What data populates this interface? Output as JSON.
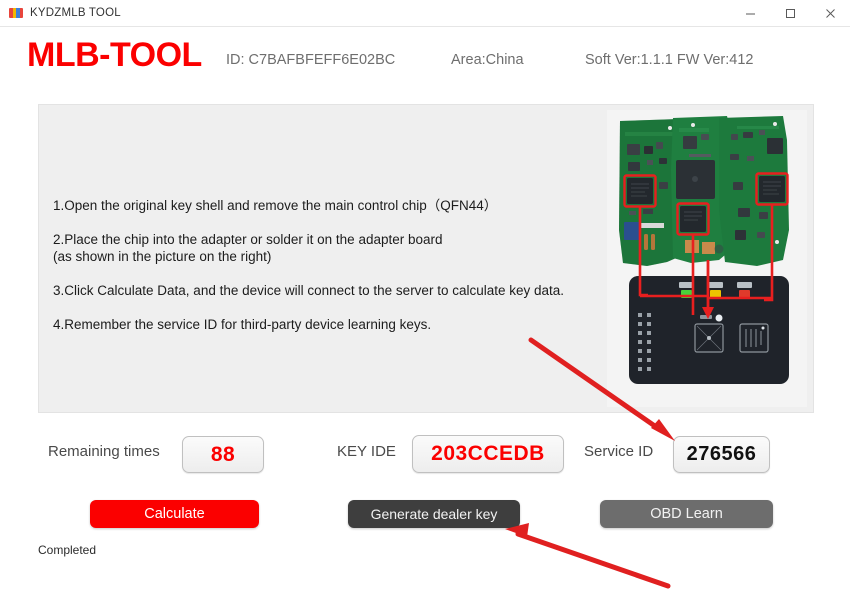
{
  "window": {
    "title": "KYDZMLB TOOL",
    "icon": "app-logo-icon",
    "minimize_label": "minimize-icon",
    "maximize_label": "maximize-icon",
    "close_label": "close-icon"
  },
  "header": {
    "brand": "MLB-TOOL",
    "brand_color": "#FB0000",
    "device_id": "ID: C7BAFBFEFF6E02BC",
    "area": "Area:China",
    "versions": "Soft Ver:1.1.1  FW Ver:412"
  },
  "instructions": {
    "steps": [
      "1.Open the original key shell and remove the main control chip（QFN44）",
      "2.Place the chip into the adapter or solder it on the adapter board\n(as shown in the picture on the right)",
      "3.Click Calculate Data, and the device will connect to the server to calculate key data.",
      "4.Remember the service ID for third-party device learning keys."
    ],
    "step1": "1.Open the original key shell and remove the main control chip（QFN44）",
    "step2_line1": "2.Place the chip into the adapter or solder it on the adapter board",
    "step2_line2": "(as shown in the picture on the right)",
    "step3": "3.Click Calculate Data, and the device will connect to the server to calculate key data.",
    "step4": "4.Remember the service ID for third-party device learning keys."
  },
  "illustration": {
    "name": "pcb-and-adapter-photo",
    "description": "Photo of three green key PCBs above a black adapter device with highlighted chip locations"
  },
  "fields": {
    "remaining": {
      "label": "Remaining times",
      "value": "88",
      "color": "#FB0000"
    },
    "key_ide": {
      "label": "KEY IDE",
      "value": "203CCEDB",
      "color": "#FB0000"
    },
    "service_id": {
      "label": "Service ID",
      "value": "276566",
      "color": "#111111"
    }
  },
  "buttons": {
    "calculate": {
      "label": "Calculate",
      "color": "#FB0000"
    },
    "generate_dealer_key": {
      "label": "Generate dealer key",
      "color": "#3E3E3E"
    },
    "obd_learn": {
      "label": "OBD Learn",
      "color": "#6D6D6D"
    }
  },
  "status": {
    "text": "Completed"
  },
  "annotations": {
    "arrow_color": "#E02020",
    "arrow_to_service_id": "points to the Service ID field",
    "arrow_to_generate_dealer_key": "points to the Generate dealer key button"
  }
}
